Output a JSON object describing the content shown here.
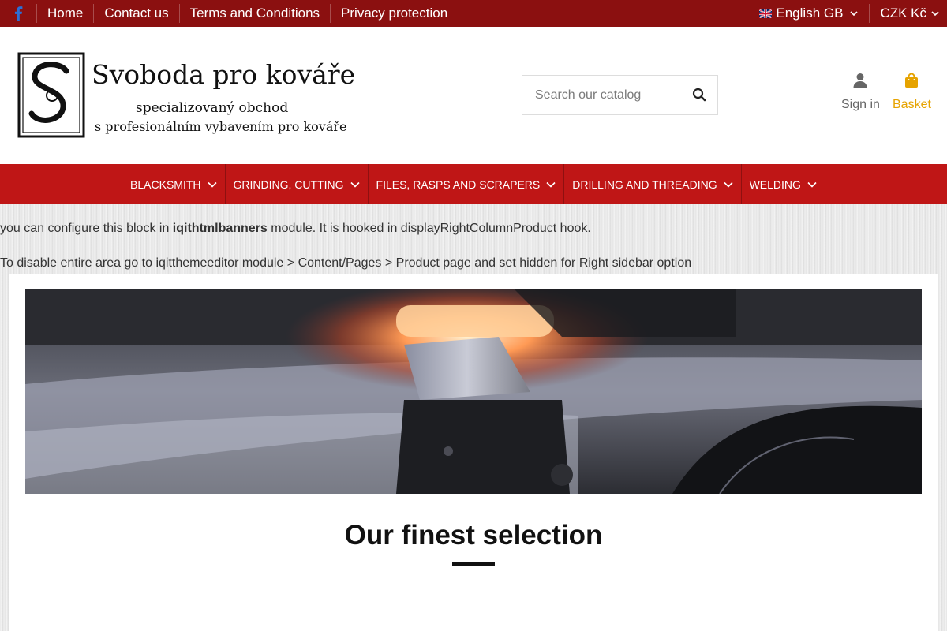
{
  "topbar": {
    "social": "facebook-icon",
    "links": [
      "Home",
      "Contact us",
      "Terms and Conditions",
      "Privacy protection"
    ],
    "language": "English GB",
    "currency": "CZK Kč"
  },
  "header": {
    "logo_title": "Svoboda pro kováře",
    "logo_line1": "specializovaný obchod",
    "logo_line2": "s profesionálním vybavením pro kováře",
    "search_placeholder": "Search our catalog",
    "sign_in": "Sign in",
    "basket": "Basket"
  },
  "menu": {
    "items": [
      "BLACKSMITH",
      "GRINDING, CUTTING",
      "FILES, RASPS AND SCRAPERS",
      "DRILLING AND THREADING",
      "WELDING"
    ]
  },
  "notes": {
    "line1_pre": "you can configure this block in ",
    "line1_bold": "iqithtmlbanners",
    "line1_post": " module. It is hooked in displayRightColumnProduct hook.",
    "line2": "To disable entire area go to iqitthemeeditor module > Content/Pages > Product page and set hidden for Right sidebar option"
  },
  "content": {
    "section_title": "Our finest selection"
  },
  "colors": {
    "topbar": "#8b1010",
    "menu": "#bf1616",
    "basket": "#e6a300"
  }
}
